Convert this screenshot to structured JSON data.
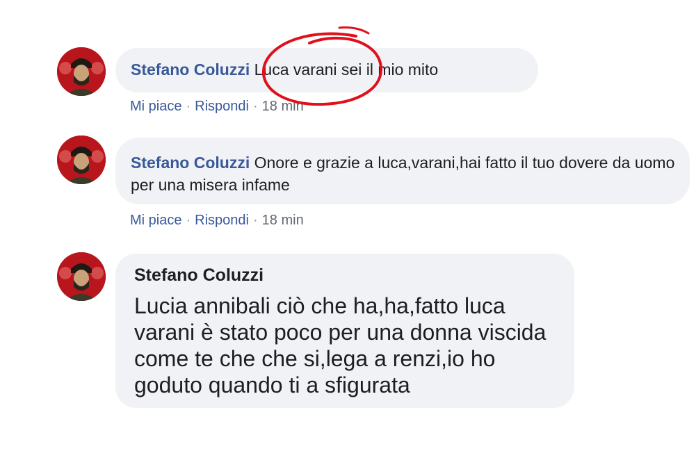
{
  "comments": [
    {
      "author": "Stefano Coluzzi",
      "text": "Luca varani sei il mio mito",
      "actions": {
        "like": "Mi piace",
        "reply": "Rispondi",
        "time": "18 min"
      }
    },
    {
      "author": "Stefano Coluzzi",
      "text": "Onore e grazie a luca,varani,hai fatto il tuo dovere da uomo per una misera infame",
      "actions": {
        "like": "Mi piace",
        "reply": "Rispondi",
        "time": "18 min"
      }
    },
    {
      "author": "Stefano Coluzzi",
      "text": "Lucia annibali ciò che ha,ha,fatto luca varani è stato poco per una donna viscida come te che che si,lega a renzi,io ho goduto quando ti a sfigurata"
    }
  ],
  "separator": "·",
  "colors": {
    "name": "#385898",
    "bubble": "#f1f2f5",
    "highlight": "#e0101a"
  }
}
